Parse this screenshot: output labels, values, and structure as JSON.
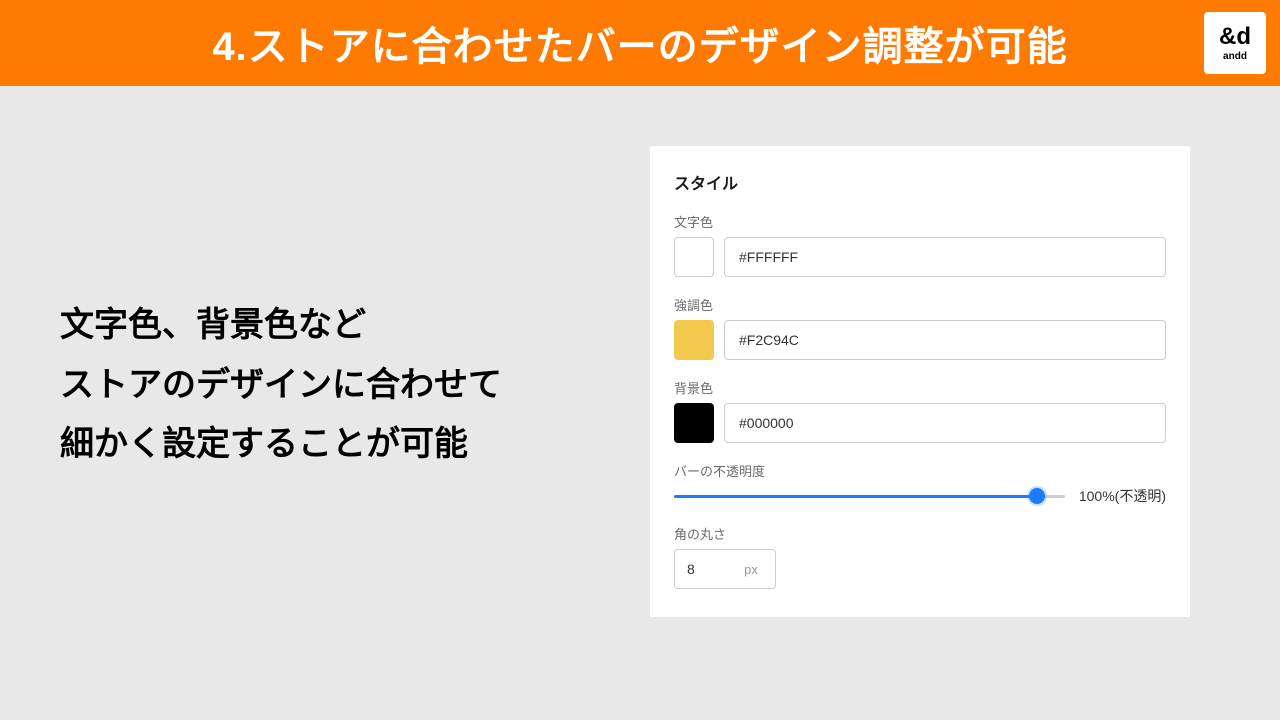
{
  "header": {
    "title": "4.ストアに合わせたバーのデザイン調整が可能",
    "logo_mark": "&d",
    "logo_sub": "andd"
  },
  "left": {
    "heading_line1": "文字色、背景色など",
    "heading_line2": "ストアのデザインに合わせて",
    "heading_line3": "細かく設定することが可能"
  },
  "panel": {
    "title": "スタイル",
    "text_color": {
      "label": "文字色",
      "value": "#FFFFFF",
      "swatch": "#FFFFFF"
    },
    "accent_color": {
      "label": "強調色",
      "value": "#F2C94C",
      "swatch": "#F2C94C"
    },
    "bg_color": {
      "label": "背景色",
      "value": "#000000",
      "swatch": "#000000"
    },
    "opacity": {
      "label": "バーの不透明度",
      "value_text": "100%(不透明)",
      "percent": 100
    },
    "radius": {
      "label": "角の丸さ",
      "value": "8",
      "unit": "px"
    }
  }
}
